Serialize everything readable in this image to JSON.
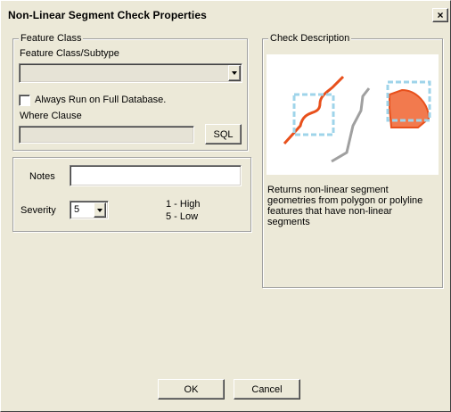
{
  "window": {
    "title": "Non-Linear Segment Check Properties",
    "close_glyph": "×"
  },
  "feature_class": {
    "group_label": "Feature Class",
    "subtype_label": "Feature Class/Subtype",
    "subtype_value": "",
    "always_run_label": "Always Run on Full Database.",
    "always_run_checked": false,
    "where_clause_label": "Where Clause",
    "where_clause_value": "",
    "sql_button": "SQL"
  },
  "properties": {
    "notes_label": "Notes",
    "notes_value": "",
    "severity_label": "Severity",
    "severity_value": "5",
    "severity_high": "1 - High",
    "severity_low": "5 - Low"
  },
  "check_description": {
    "group_label": "Check Description",
    "text": "Returns non-linear segment\ngeometries from polygon or polyline\nfeatures that have non-linear\nsegments",
    "colors": {
      "line": "#e8501c",
      "polygon_fill": "#f27a4e",
      "selection_box": "#9fd4ea",
      "gray_line": "#a0a0a0"
    }
  },
  "buttons": {
    "ok": "OK",
    "cancel": "Cancel"
  }
}
